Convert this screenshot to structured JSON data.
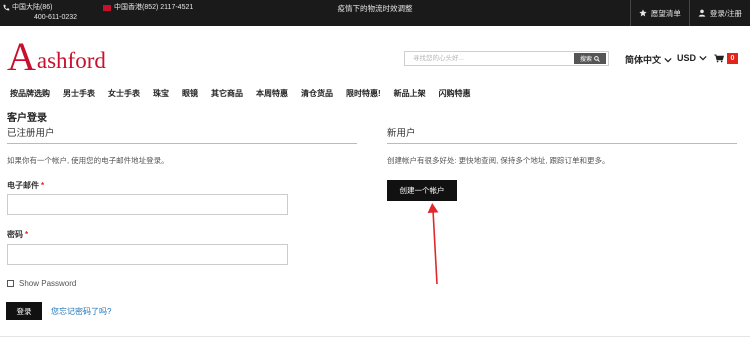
{
  "topbar": {
    "phone_region": "中国大陆(86)",
    "phone_number": "400-611-0232",
    "hk_phone": "中国香港(852) 2117-4521",
    "notice": "疫情下的物流时效调整",
    "wishlist": "愿望清单",
    "account": "登录/注册"
  },
  "header": {
    "logo_mark": "A",
    "logo_text": "ashford",
    "search_placeholder": "寻找您的心头好...",
    "search_button": "搜索",
    "language": "简体中文",
    "currency": "USD",
    "cart_count": "0"
  },
  "nav": {
    "items": [
      "按品牌选购",
      "男士手表",
      "女士手表",
      "珠宝",
      "眼镜",
      "其它商品",
      "本周特惠",
      "清仓货品",
      "限时特惠!",
      "新品上架",
      "闪购特惠"
    ]
  },
  "login": {
    "page_title": "客户登录",
    "registered_title": "已注册用户",
    "registered_hint": "如果你有一个帐户, 使用您的电子邮件地址登录。",
    "email_label": "电子邮件",
    "password_label": "密码",
    "required_mark": "*",
    "show_password": "Show Password",
    "login_button": "登录",
    "forgot_link": "您忘记密码了吗?",
    "new_title": "新用户",
    "new_hint": "创建帐户有很多好处: 更快地查阅, 保持多个地址, 跟踪订单和更多。",
    "create_button": "创建一个帐户"
  },
  "colors": {
    "brand_red": "#c8102e",
    "topbar_bg": "#1a1a1a",
    "button_bg": "#111111",
    "link_blue": "#1a73b8",
    "annotation_arrow": "#e0292c"
  }
}
